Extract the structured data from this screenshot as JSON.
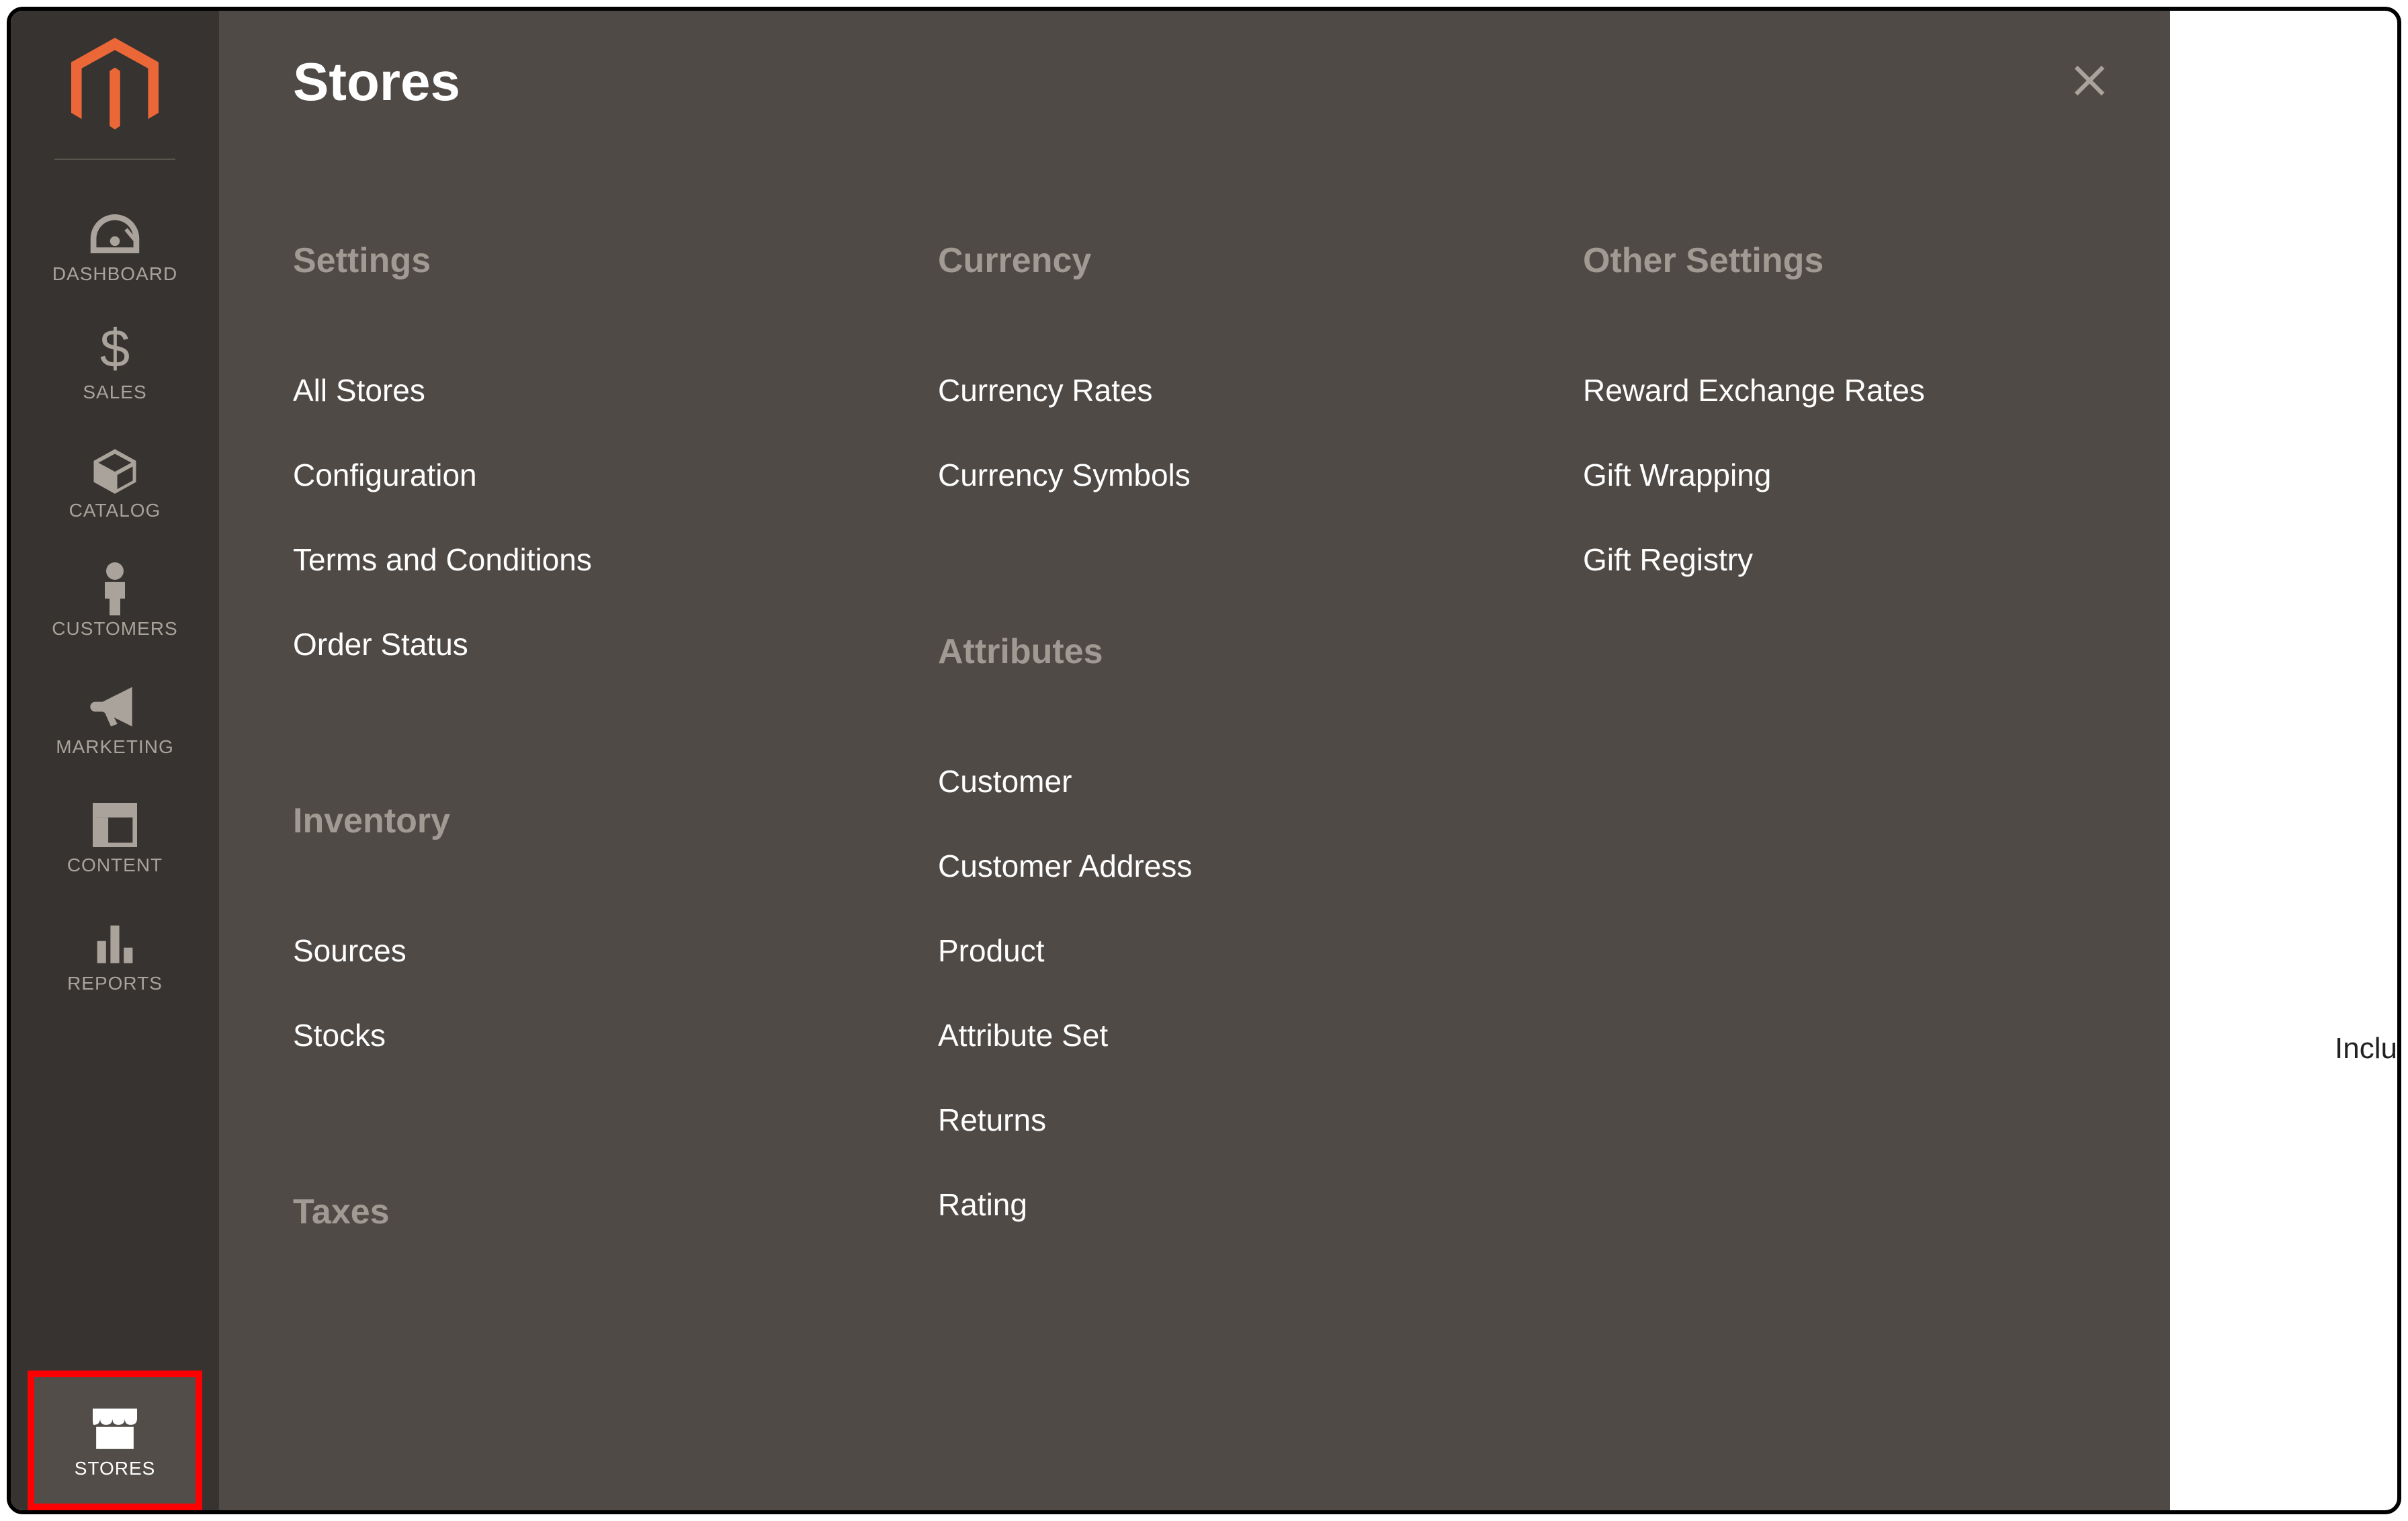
{
  "sidebar": {
    "items": [
      {
        "label": "DASHBOARD"
      },
      {
        "label": "SALES"
      },
      {
        "label": "CATALOG"
      },
      {
        "label": "CUSTOMERS"
      },
      {
        "label": "MARKETING"
      },
      {
        "label": "CONTENT"
      },
      {
        "label": "REPORTS"
      },
      {
        "label": "STORES"
      }
    ]
  },
  "panel": {
    "title": "Stores",
    "columns": [
      {
        "groups": [
          {
            "heading": "Settings",
            "links": [
              {
                "label": "All Stores",
                "highlighted": false
              },
              {
                "label": "Configuration",
                "highlighted": true
              },
              {
                "label": "Terms and Conditions",
                "highlighted": false
              },
              {
                "label": "Order Status",
                "highlighted": false
              }
            ]
          },
          {
            "heading": "Inventory",
            "links": [
              {
                "label": "Sources"
              },
              {
                "label": "Stocks"
              }
            ]
          },
          {
            "heading": "Taxes",
            "links": []
          }
        ]
      },
      {
        "groups": [
          {
            "heading": "Currency",
            "links": [
              {
                "label": "Currency Rates"
              },
              {
                "label": "Currency Symbols"
              }
            ]
          },
          {
            "heading": "Attributes",
            "links": [
              {
                "label": "Customer"
              },
              {
                "label": "Customer Address"
              },
              {
                "label": "Product"
              },
              {
                "label": "Attribute Set"
              },
              {
                "label": "Returns"
              },
              {
                "label": "Rating"
              }
            ]
          }
        ]
      },
      {
        "groups": [
          {
            "heading": "Other Settings",
            "links": [
              {
                "label": "Reward Exchange Rates"
              },
              {
                "label": "Gift Wrapping"
              },
              {
                "label": "Gift Registry"
              }
            ]
          }
        ]
      }
    ]
  },
  "background_text": "Inclu"
}
